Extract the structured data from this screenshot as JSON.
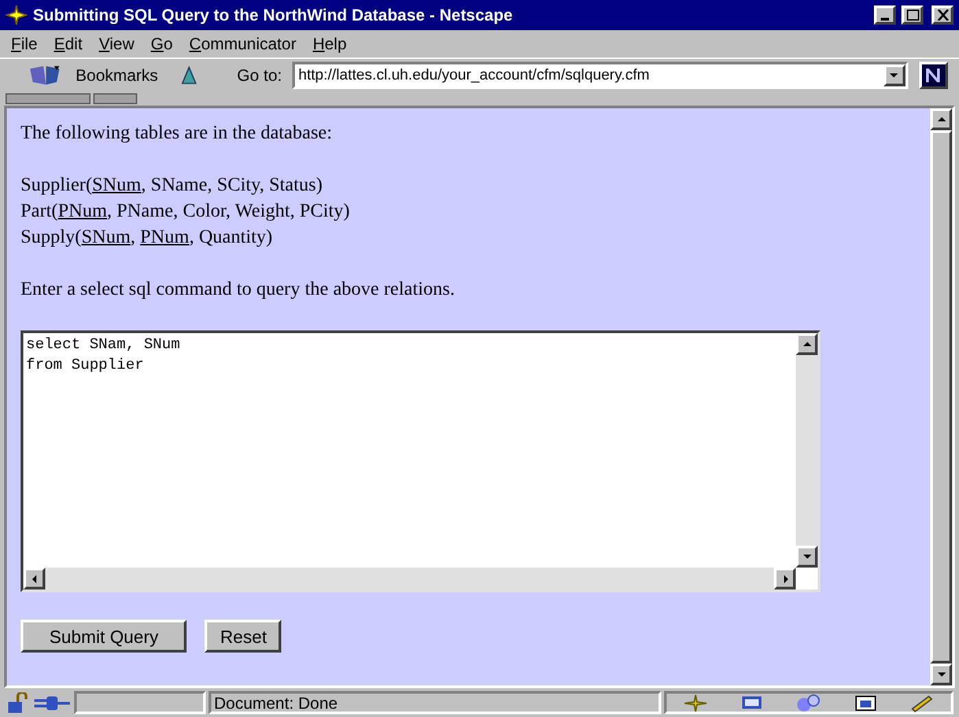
{
  "window": {
    "title": "Submitting SQL Query to the NorthWind Database - Netscape"
  },
  "menu": [
    "File",
    "Edit",
    "View",
    "Go",
    "Communicator",
    "Help"
  ],
  "toolbar": {
    "bookmarks": "Bookmarks",
    "goto_label": "Go to:",
    "url": "http://lattes.cl.uh.edu/your_account/cfm/sqlquery.cfm"
  },
  "page": {
    "intro": "The following tables are in the database:",
    "relations": [
      {
        "segments": [
          {
            "text": "Supplier(",
            "key": false
          },
          {
            "text": "SNum",
            "key": true
          },
          {
            "text": ", SName, SCity, Status)",
            "key": false
          }
        ]
      },
      {
        "segments": [
          {
            "text": "Part(",
            "key": false
          },
          {
            "text": "PNum",
            "key": true
          },
          {
            "text": ", PName, Color, Weight, PCity)",
            "key": false
          }
        ]
      },
      {
        "segments": [
          {
            "text": "Supply(",
            "key": false
          },
          {
            "text": "SNum",
            "key": true
          },
          {
            "text": ", ",
            "key": false
          },
          {
            "text": "PNum",
            "key": true
          },
          {
            "text": ", Quantity)",
            "key": false
          }
        ]
      }
    ],
    "prompt": "Enter a select sql command to query the above relations.",
    "query": "select SNam, SNum\nfrom Supplier",
    "buttons": [
      "Submit Query",
      "Reset"
    ]
  },
  "status_bar": {
    "text": "Document: Done"
  }
}
